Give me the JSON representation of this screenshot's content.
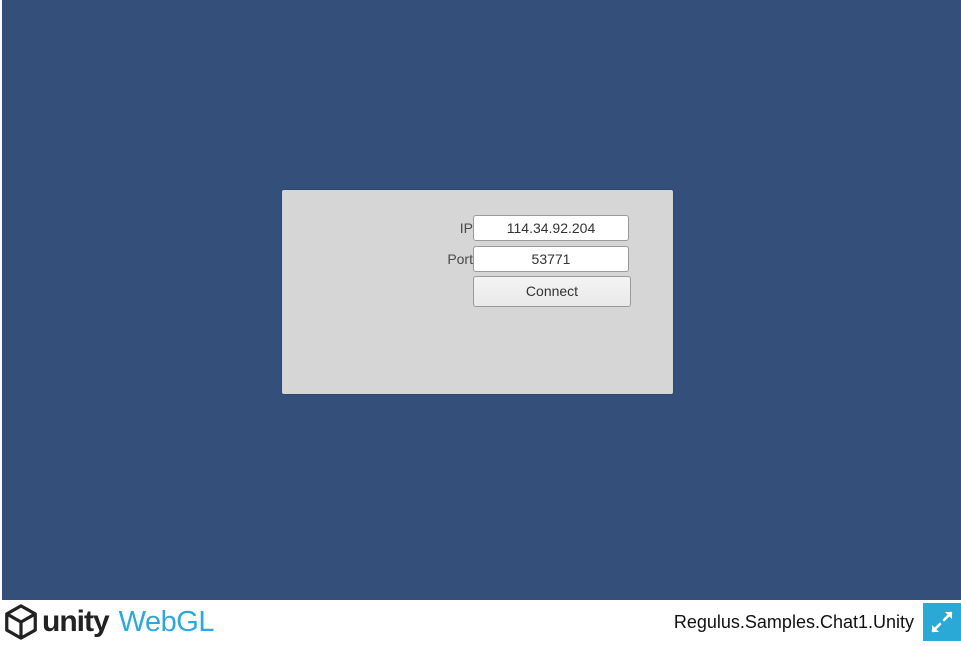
{
  "app": {
    "title": "Regulus.Samples.Chat1.Unity",
    "brand": {
      "unity": "unity",
      "webgl": "WebGL"
    },
    "colors": {
      "canvas_bg": "#344f7a",
      "panel_bg": "#d6d6d6",
      "webgl_blue": "#2ea8d8",
      "fullscreen_bg": "#2aa8d6"
    }
  },
  "form": {
    "ip_label": "IP",
    "ip_value": "114.34.92.204",
    "port_label": "Port",
    "port_value": "53771",
    "connect_label": "Connect"
  },
  "icons": {
    "logo": "unity-cube-icon",
    "fullscreen": "fullscreen-expand-icon"
  }
}
